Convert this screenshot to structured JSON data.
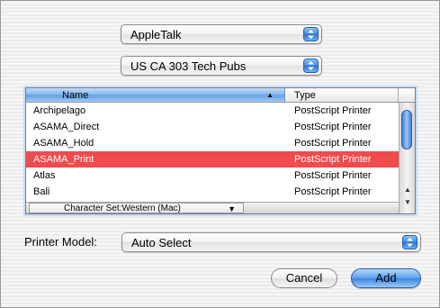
{
  "connection_popup": {
    "value": "AppleTalk"
  },
  "zone_popup": {
    "value": "US CA 303 Tech Pubs"
  },
  "printer_list": {
    "columns": {
      "name": "Name",
      "type": "Type"
    },
    "rows": [
      {
        "name": "Archipelago",
        "type": "PostScript Printer",
        "selected": false
      },
      {
        "name": "ASAMA_Direct",
        "type": "PostScript Printer",
        "selected": false
      },
      {
        "name": "ASAMA_Hold",
        "type": "PostScript Printer",
        "selected": false
      },
      {
        "name": "ASAMA_Print",
        "type": "PostScript Printer",
        "selected": true
      },
      {
        "name": "Atlas",
        "type": "PostScript Printer",
        "selected": false
      },
      {
        "name": "Bali",
        "type": "PostScript Printer",
        "selected": false
      }
    ],
    "selection_color": "#f04b4d",
    "character_set": "Character Set:Western (Mac)"
  },
  "printer_model": {
    "label": "Printer Model:",
    "value": "Auto Select"
  },
  "buttons": {
    "cancel": "Cancel",
    "add": "Add"
  }
}
